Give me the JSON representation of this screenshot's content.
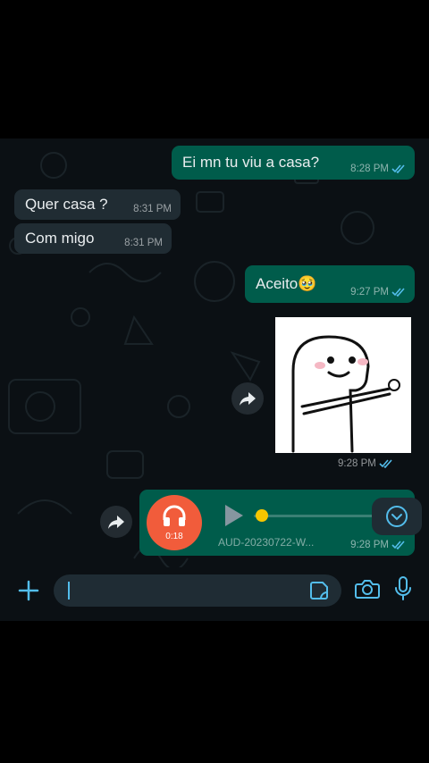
{
  "messages": [
    {
      "id": "m1",
      "direction": "outgoing",
      "text": "Ei mn tu viu a casa?",
      "time": "8:28 PM",
      "status": "read"
    },
    {
      "id": "m2",
      "direction": "incoming",
      "text": "Quer casa ?",
      "time": "8:31 PM"
    },
    {
      "id": "m3",
      "direction": "incoming",
      "text": "Com migo",
      "time": "8:31 PM"
    },
    {
      "id": "m4",
      "direction": "outgoing",
      "text": "Aceito🥹",
      "time": "9:27 PM",
      "status": "read"
    },
    {
      "id": "m5",
      "direction": "outgoing",
      "type": "sticker",
      "sticker": "flork-meme-holding-ring",
      "time": "9:28 PM",
      "status": "read"
    },
    {
      "id": "m6",
      "direction": "outgoing",
      "type": "audio",
      "duration": "0:18",
      "filename": "AUD-20230722-W...",
      "time": "9:28 PM",
      "status": "read",
      "progress": 0.1
    }
  ],
  "input": {
    "placeholder": "",
    "value": ""
  },
  "colors": {
    "outgoing": "#005c4b",
    "incoming": "#202c33",
    "background": "#0b1014",
    "accent": "#53bdeb",
    "audio_avatar": "#f15c3b"
  },
  "icons": [
    "forward-icon",
    "headphones-icon",
    "play-icon",
    "scroll-down-icon",
    "plus-icon",
    "sticker-icon",
    "camera-icon",
    "mic-icon",
    "read-ticks-icon"
  ]
}
